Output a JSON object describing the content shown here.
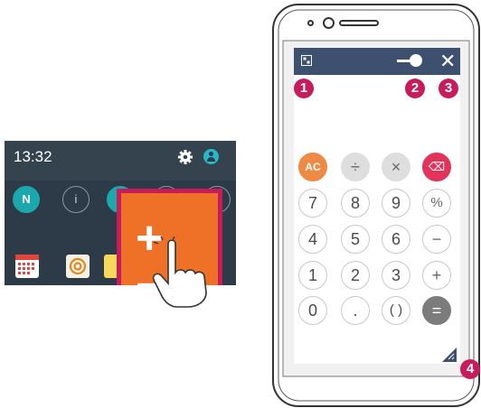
{
  "left_panel": {
    "time": "13:32",
    "quick_settings": [
      {
        "label": "N",
        "state": "on",
        "icon": "nfc-icon"
      },
      {
        "label": "i",
        "state": "off",
        "icon": "flashlight-icon"
      },
      {
        "label": "",
        "state": "on",
        "icon": "qslide-icon"
      },
      {
        "label": "",
        "state": "off",
        "icon": "toggle-icon"
      },
      {
        "label": "",
        "state": "off",
        "icon": "toggle-icon"
      }
    ],
    "qslide_app_glyph": "+ =",
    "app_tiles": [
      "calendar-icon",
      "email-icon",
      "memo-icon"
    ]
  },
  "calculator": {
    "keys": [
      [
        "AC",
        "÷",
        "×",
        "⌫"
      ],
      [
        "7",
        "8",
        "9",
        "%"
      ],
      [
        "4",
        "5",
        "6",
        "−"
      ],
      [
        "1",
        "2",
        "3",
        "+"
      ],
      [
        "0",
        ".",
        "( )",
        "="
      ]
    ]
  },
  "callouts": [
    "1",
    "2",
    "3",
    "4"
  ],
  "colors": {
    "titlebar": "#3e5070",
    "callout": "#c81b5c",
    "ac_key": "#ef8a45",
    "delete_key": "#e2335a",
    "qslide_tile": "#ee7127",
    "panel_bg": "#2d3a47"
  }
}
